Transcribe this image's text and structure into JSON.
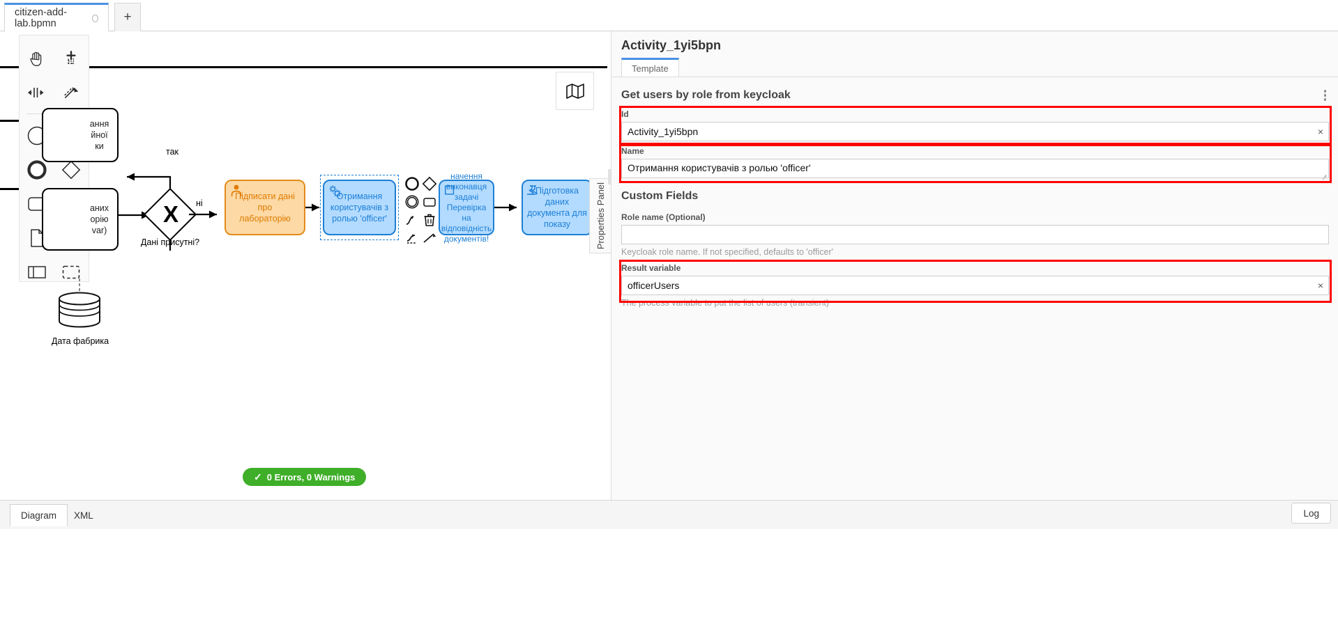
{
  "window": {
    "tabs": [
      {
        "label": "citizen-add-lab.bpmn",
        "dirty": true,
        "active": true
      },
      {
        "label": "+",
        "active": false
      }
    ]
  },
  "canvas": {
    "minimap_icon": "map-icon",
    "palette": {
      "tools": [
        "hand-tool-icon",
        "lasso-tool-icon",
        "space-tool-icon",
        "global-connect-tool-icon"
      ],
      "shapes": [
        "start-event-icon",
        "intermediate-event-icon",
        "end-event-icon",
        "exclusive-gateway-icon",
        "task-icon",
        "subprocess-expanded-icon",
        "data-object-icon",
        "data-store-icon",
        "participant-icon",
        "group-icon"
      ]
    },
    "nodes": [
      {
        "id": "task-signed",
        "label": "...ання\n...йної\n...ки",
        "type": "task",
        "color": "default"
      },
      {
        "id": "task-data",
        "label": "...аних\n...орію\n...var)",
        "type": "task",
        "color": "default"
      },
      {
        "id": "gateway",
        "label": "Дані присутні?",
        "type": "exclusive-gateway",
        "marker": "X"
      },
      {
        "id": "task-sign-lab",
        "label": "Підписати дані про лабораторію",
        "type": "user-task",
        "color": "orange"
      },
      {
        "id": "task-get-users",
        "label": "Отримання користувачів з ролью 'officer'",
        "type": "service-task",
        "color": "blue",
        "selected": true
      },
      {
        "id": "task-check-docs",
        "label": "начення виконавця задачі Перевірка на відповідність документів!",
        "type": "user-task",
        "color": "blue"
      },
      {
        "id": "task-prepare-doc",
        "label": "Підготовка даних документа для показу",
        "type": "script-task",
        "color": "blue"
      },
      {
        "id": "datastore-fabric",
        "label": "Дата фабрика",
        "type": "data-store"
      }
    ],
    "edge_labels": [
      "так",
      "ні"
    ],
    "context_pad": [
      "append-end-event-icon",
      "append-gateway-icon",
      "append-task-icon",
      "append-intermediate-event-icon",
      "append-text-annotation-icon",
      "connect-icon",
      "delete-icon",
      "change-type-icon",
      "append-append-icon"
    ]
  },
  "status": {
    "icon": "check-icon",
    "text": "0 Errors, 0 Warnings",
    "color": "#3fae29"
  },
  "bottom": {
    "tabs": [
      {
        "label": "Diagram",
        "active": true
      },
      {
        "label": "XML",
        "active": false
      }
    ],
    "log_label": "Log"
  },
  "properties_panel": {
    "handle_label": "Properties Panel",
    "element_id": "Activity_1yi5bpn",
    "tabs": [
      {
        "label": "Template",
        "active": true
      }
    ],
    "group": {
      "title": "Get users by role from keycloak",
      "menu_icon": "kebab-menu-icon"
    },
    "fields": {
      "id": {
        "label": "Id",
        "value": "Activity_1yi5bpn",
        "clear_icon": "×",
        "highlighted": true
      },
      "name": {
        "label": "Name",
        "value": "Отримання користувачів з ролью 'officer'",
        "highlighted": true
      },
      "custom_fields_title": "Custom Fields",
      "role_name": {
        "label": "Role name (Optional)",
        "value": "",
        "placeholder": "",
        "hint": "Keycloak role name. If not specified, defaults to 'officer'",
        "highlighted": false
      },
      "result_variable": {
        "label": "Result variable",
        "value": "officerUsers",
        "clear_icon": "×",
        "hint": "The process variable to put the list of users (transient)",
        "highlighted": true
      }
    },
    "highlight_color": "#ff0000"
  }
}
